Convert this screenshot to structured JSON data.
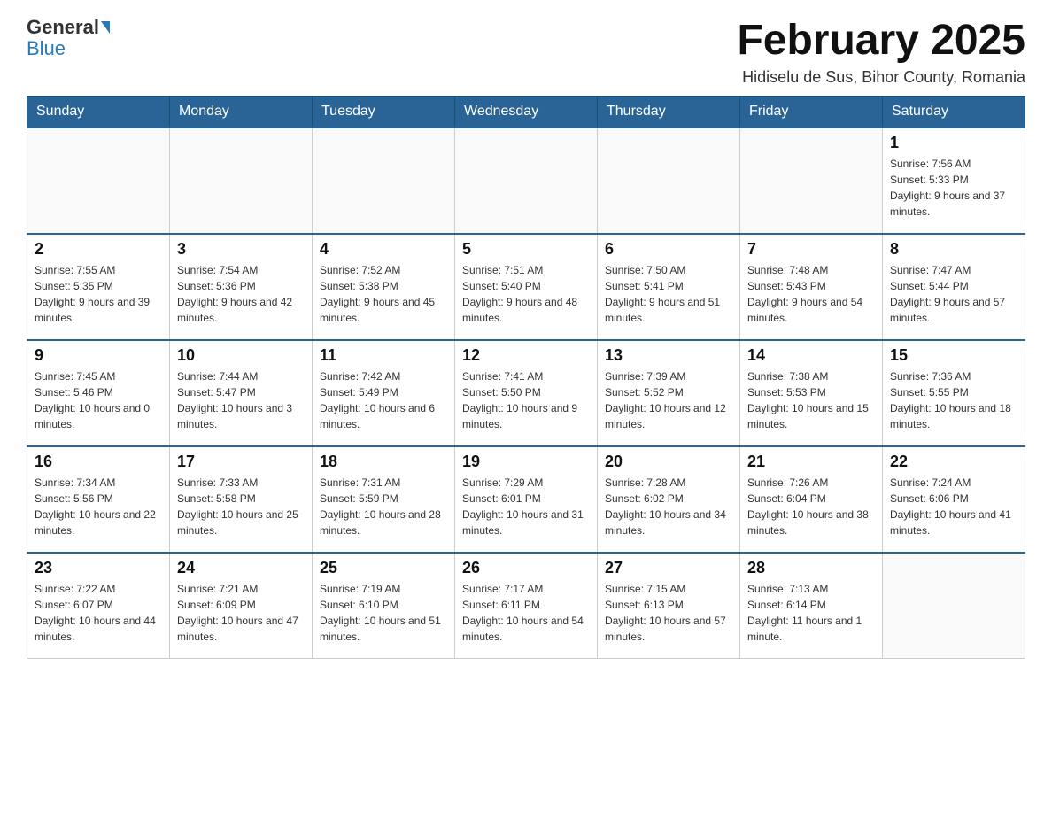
{
  "header": {
    "logo": {
      "general": "General",
      "blue": "Blue"
    },
    "title": "February 2025",
    "subtitle": "Hidiselu de Sus, Bihor County, Romania"
  },
  "days_of_week": [
    "Sunday",
    "Monday",
    "Tuesday",
    "Wednesday",
    "Thursday",
    "Friday",
    "Saturday"
  ],
  "weeks": [
    {
      "days": [
        {
          "number": "",
          "info": ""
        },
        {
          "number": "",
          "info": ""
        },
        {
          "number": "",
          "info": ""
        },
        {
          "number": "",
          "info": ""
        },
        {
          "number": "",
          "info": ""
        },
        {
          "number": "",
          "info": ""
        },
        {
          "number": "1",
          "info": "Sunrise: 7:56 AM\nSunset: 5:33 PM\nDaylight: 9 hours and 37 minutes."
        }
      ]
    },
    {
      "days": [
        {
          "number": "2",
          "info": "Sunrise: 7:55 AM\nSunset: 5:35 PM\nDaylight: 9 hours and 39 minutes."
        },
        {
          "number": "3",
          "info": "Sunrise: 7:54 AM\nSunset: 5:36 PM\nDaylight: 9 hours and 42 minutes."
        },
        {
          "number": "4",
          "info": "Sunrise: 7:52 AM\nSunset: 5:38 PM\nDaylight: 9 hours and 45 minutes."
        },
        {
          "number": "5",
          "info": "Sunrise: 7:51 AM\nSunset: 5:40 PM\nDaylight: 9 hours and 48 minutes."
        },
        {
          "number": "6",
          "info": "Sunrise: 7:50 AM\nSunset: 5:41 PM\nDaylight: 9 hours and 51 minutes."
        },
        {
          "number": "7",
          "info": "Sunrise: 7:48 AM\nSunset: 5:43 PM\nDaylight: 9 hours and 54 minutes."
        },
        {
          "number": "8",
          "info": "Sunrise: 7:47 AM\nSunset: 5:44 PM\nDaylight: 9 hours and 57 minutes."
        }
      ]
    },
    {
      "days": [
        {
          "number": "9",
          "info": "Sunrise: 7:45 AM\nSunset: 5:46 PM\nDaylight: 10 hours and 0 minutes."
        },
        {
          "number": "10",
          "info": "Sunrise: 7:44 AM\nSunset: 5:47 PM\nDaylight: 10 hours and 3 minutes."
        },
        {
          "number": "11",
          "info": "Sunrise: 7:42 AM\nSunset: 5:49 PM\nDaylight: 10 hours and 6 minutes."
        },
        {
          "number": "12",
          "info": "Sunrise: 7:41 AM\nSunset: 5:50 PM\nDaylight: 10 hours and 9 minutes."
        },
        {
          "number": "13",
          "info": "Sunrise: 7:39 AM\nSunset: 5:52 PM\nDaylight: 10 hours and 12 minutes."
        },
        {
          "number": "14",
          "info": "Sunrise: 7:38 AM\nSunset: 5:53 PM\nDaylight: 10 hours and 15 minutes."
        },
        {
          "number": "15",
          "info": "Sunrise: 7:36 AM\nSunset: 5:55 PM\nDaylight: 10 hours and 18 minutes."
        }
      ]
    },
    {
      "days": [
        {
          "number": "16",
          "info": "Sunrise: 7:34 AM\nSunset: 5:56 PM\nDaylight: 10 hours and 22 minutes."
        },
        {
          "number": "17",
          "info": "Sunrise: 7:33 AM\nSunset: 5:58 PM\nDaylight: 10 hours and 25 minutes."
        },
        {
          "number": "18",
          "info": "Sunrise: 7:31 AM\nSunset: 5:59 PM\nDaylight: 10 hours and 28 minutes."
        },
        {
          "number": "19",
          "info": "Sunrise: 7:29 AM\nSunset: 6:01 PM\nDaylight: 10 hours and 31 minutes."
        },
        {
          "number": "20",
          "info": "Sunrise: 7:28 AM\nSunset: 6:02 PM\nDaylight: 10 hours and 34 minutes."
        },
        {
          "number": "21",
          "info": "Sunrise: 7:26 AM\nSunset: 6:04 PM\nDaylight: 10 hours and 38 minutes."
        },
        {
          "number": "22",
          "info": "Sunrise: 7:24 AM\nSunset: 6:06 PM\nDaylight: 10 hours and 41 minutes."
        }
      ]
    },
    {
      "days": [
        {
          "number": "23",
          "info": "Sunrise: 7:22 AM\nSunset: 6:07 PM\nDaylight: 10 hours and 44 minutes."
        },
        {
          "number": "24",
          "info": "Sunrise: 7:21 AM\nSunset: 6:09 PM\nDaylight: 10 hours and 47 minutes."
        },
        {
          "number": "25",
          "info": "Sunrise: 7:19 AM\nSunset: 6:10 PM\nDaylight: 10 hours and 51 minutes."
        },
        {
          "number": "26",
          "info": "Sunrise: 7:17 AM\nSunset: 6:11 PM\nDaylight: 10 hours and 54 minutes."
        },
        {
          "number": "27",
          "info": "Sunrise: 7:15 AM\nSunset: 6:13 PM\nDaylight: 10 hours and 57 minutes."
        },
        {
          "number": "28",
          "info": "Sunrise: 7:13 AM\nSunset: 6:14 PM\nDaylight: 11 hours and 1 minute."
        },
        {
          "number": "",
          "info": ""
        }
      ]
    }
  ]
}
